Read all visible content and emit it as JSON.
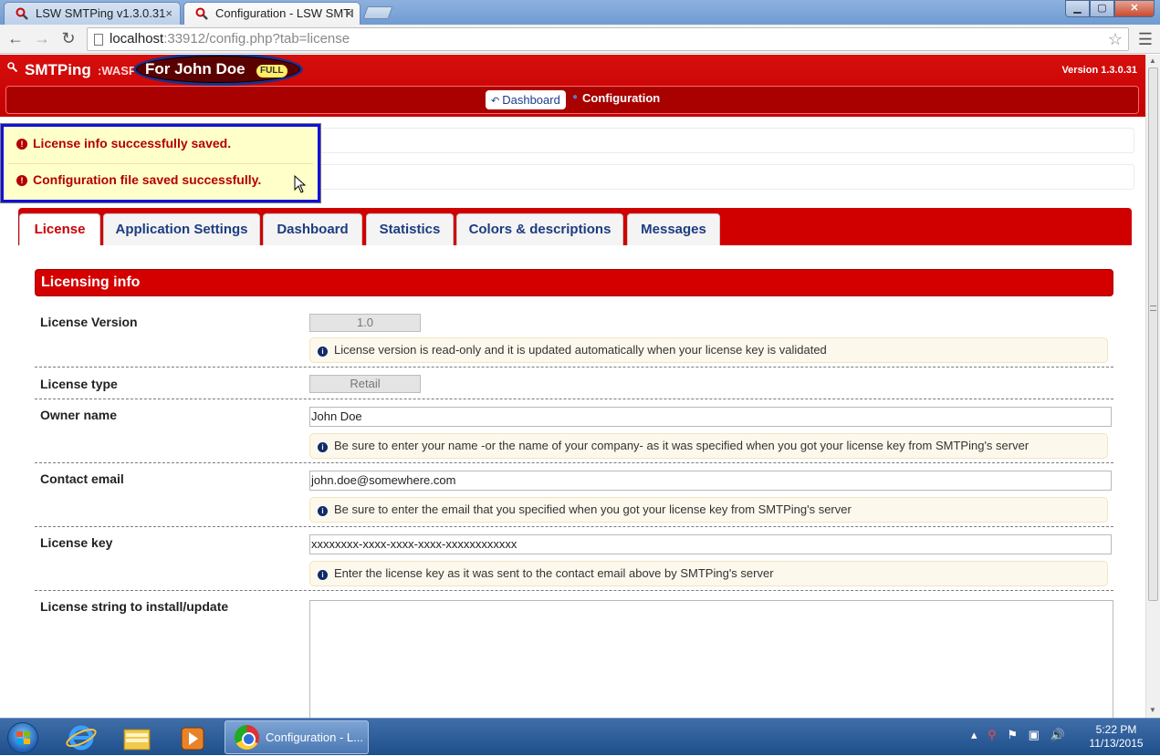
{
  "browser": {
    "tabs": [
      {
        "label": "LSW SMTPing v1.3.0.31",
        "close": "×"
      },
      {
        "label": "Configuration - LSW SMTI",
        "close": "×"
      }
    ],
    "url_host": "localhost",
    "url_path": ":33912/config.php?tab=license",
    "window_controls": {
      "minimize": "▁",
      "maximize": "▢",
      "close": "✕"
    }
  },
  "app": {
    "brand": "SMTPing",
    "brand_suffix": ":WASP",
    "owner_label": "For John Doe",
    "edition_badge": "FULL",
    "version": "Version 1.3.0.31",
    "breadcrumb": {
      "dashboard": "Dashboard",
      "current": "Configuration"
    }
  },
  "notices": [
    "License info successfully saved.",
    "Configuration file saved successfully."
  ],
  "tabs": [
    "License",
    "Application Settings",
    "Dashboard",
    "Statistics",
    "Colors & descriptions",
    "Messages"
  ],
  "active_tab": "License",
  "section_title": "Licensing info",
  "fields": {
    "license_version": {
      "label": "License Version",
      "value": "1.0",
      "hint": "License version is read-only and it is updated automatically when your license key is validated"
    },
    "license_type": {
      "label": "License type",
      "value": "Retail"
    },
    "owner_name": {
      "label": "Owner name",
      "value": "John Doe",
      "hint": "Be sure to enter your name -or the name of your company- as it was specified when you got your license key from SMTPing's server"
    },
    "contact_email": {
      "label": "Contact email",
      "value": "john.doe@somewhere.com",
      "hint": "Be sure to enter the email that you specified when you got your license key from SMTPing's server"
    },
    "license_key": {
      "label": "License key",
      "value": "xxxxxxxx-xxxx-xxxx-xxxx-xxxxxxxxxxxx",
      "hint": "Enter the license key as it was sent to the contact email above by SMTPing's server"
    },
    "license_string": {
      "label": "License string to install/update",
      "value": ""
    }
  },
  "taskbar": {
    "active_window": "Configuration - L...",
    "time": "5:22 PM",
    "date": "11/13/2015"
  },
  "colors": {
    "app_red": "#d40000",
    "nav_dark_red": "#a90000",
    "notice_bg": "#ffffc9",
    "notice_text": "#b40000",
    "annotation_blue": "#1111d9",
    "link_blue": "#1d3c80"
  }
}
